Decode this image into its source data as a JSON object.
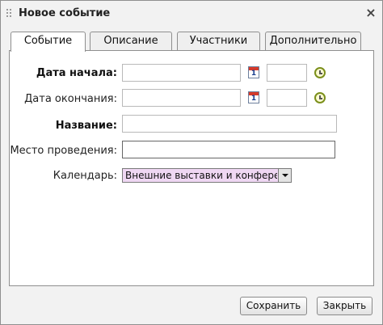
{
  "dialog": {
    "title": "Новое событие",
    "close_label": "×"
  },
  "tabs": [
    {
      "label": "Событие",
      "active": true
    },
    {
      "label": "Описание",
      "active": false
    },
    {
      "label": "Участники",
      "active": false
    },
    {
      "label": "Дополнительно",
      "active": false
    }
  ],
  "form": {
    "start_date_label": "Дата начала:",
    "end_date_label": "Дата окончания:",
    "name_label": "Название:",
    "location_label": "Место проведения:",
    "calendar_label": "Календарь:",
    "calendar_value": "Внешние выставки и конференции",
    "calendar_icon_day": "1"
  },
  "colors": {
    "calendar_select_bg": "#efd7f3",
    "calendar_icon_red": "#d63a2a"
  },
  "footer": {
    "save_label": "Сохранить",
    "close_label": "Закрыть"
  }
}
